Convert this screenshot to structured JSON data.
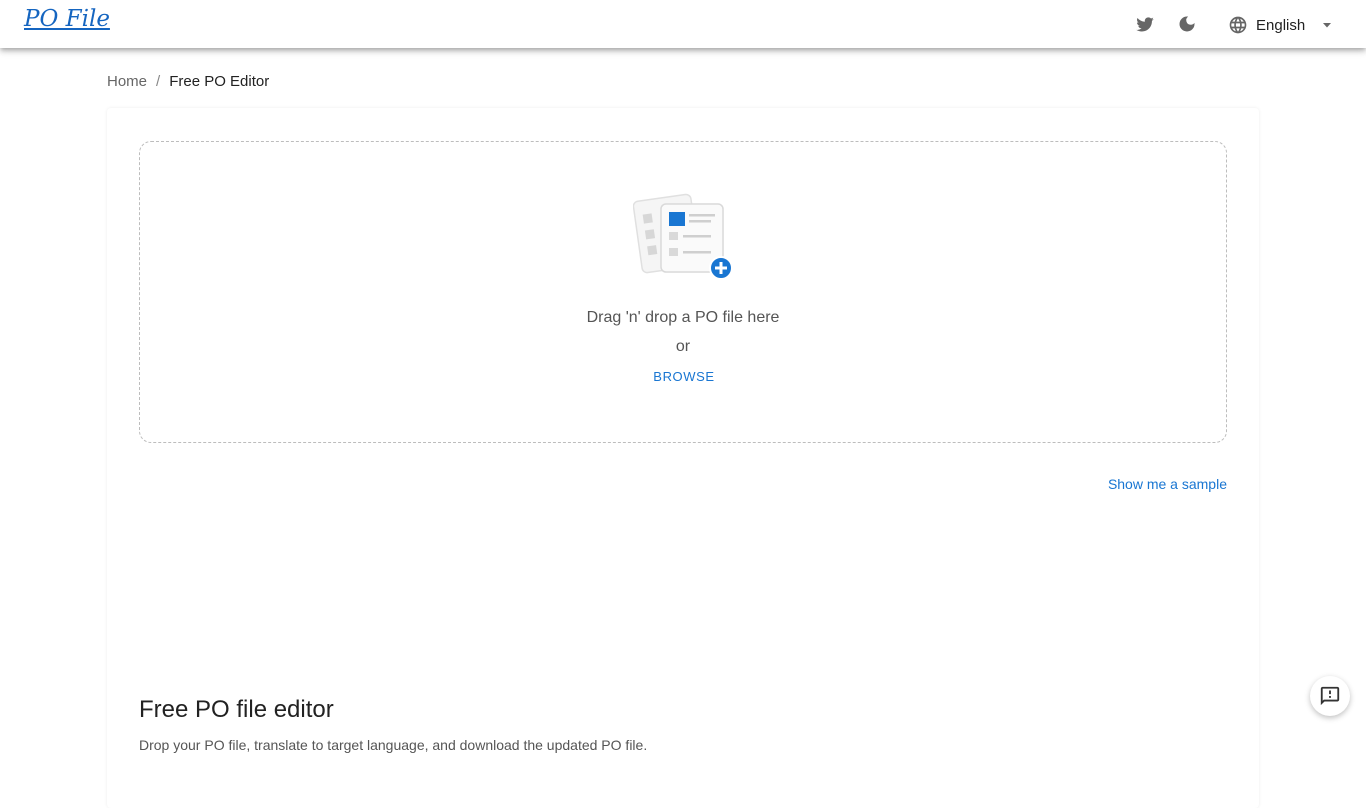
{
  "header": {
    "logo_text": "PO File",
    "twitter_icon": "twitter-icon",
    "theme_icon": "moon-icon",
    "language": {
      "icon": "globe-icon",
      "selected": "English",
      "caret_icon": "caret-down-icon"
    }
  },
  "breadcrumb": {
    "home": "Home",
    "separator": "/",
    "current": "Free PO Editor"
  },
  "dropzone": {
    "illustration_icon": "file-upload-icon",
    "instruction": "Drag 'n' drop a PO file here",
    "or_text": "or",
    "browse_label": "BROWSE"
  },
  "sample_link": "Show me a sample",
  "section": {
    "title": "Free PO file editor",
    "description": "Drop your PO file, translate to target language, and download the updated PO file."
  },
  "feedback": {
    "icon": "feedback-icon"
  },
  "colors": {
    "accent": "#1976d2",
    "logo": "#1565c0"
  }
}
